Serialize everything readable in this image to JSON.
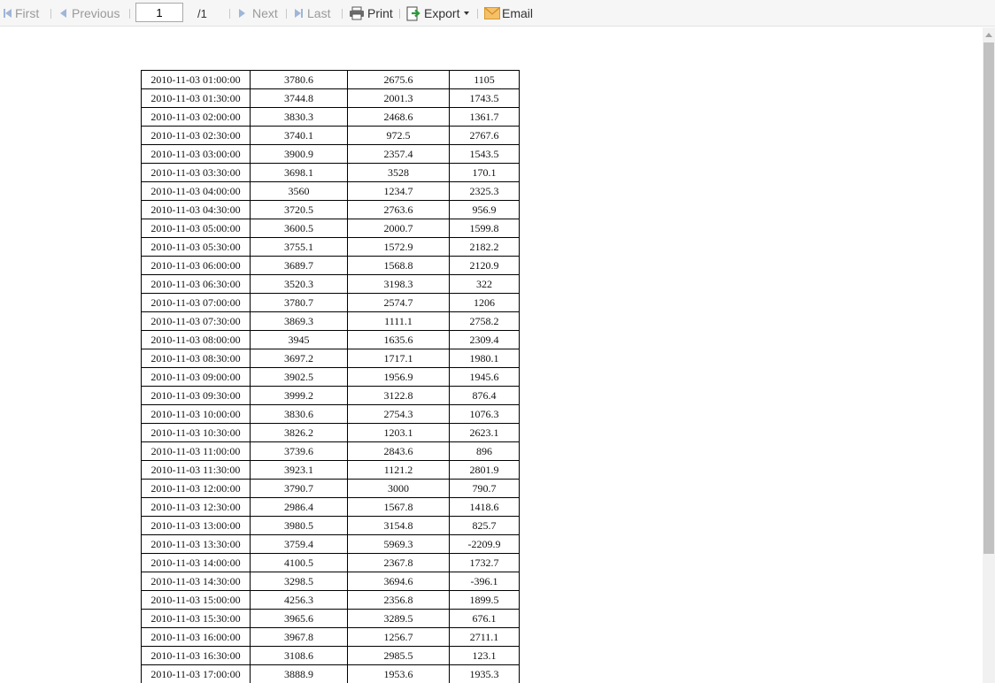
{
  "toolbar": {
    "first": "First",
    "previous": "Previous",
    "page_value": "1",
    "page_total": "/1",
    "next": "Next",
    "last": "Last",
    "print": "Print",
    "export": "Export",
    "email": "Email"
  },
  "rows": [
    [
      "2010-11-03 01:00:00",
      "3780.6",
      "2675.6",
      "1105"
    ],
    [
      "2010-11-03 01:30:00",
      "3744.8",
      "2001.3",
      "1743.5"
    ],
    [
      "2010-11-03 02:00:00",
      "3830.3",
      "2468.6",
      "1361.7"
    ],
    [
      "2010-11-03 02:30:00",
      "3740.1",
      "972.5",
      "2767.6"
    ],
    [
      "2010-11-03 03:00:00",
      "3900.9",
      "2357.4",
      "1543.5"
    ],
    [
      "2010-11-03 03:30:00",
      "3698.1",
      "3528",
      "170.1"
    ],
    [
      "2010-11-03 04:00:00",
      "3560",
      "1234.7",
      "2325.3"
    ],
    [
      "2010-11-03 04:30:00",
      "3720.5",
      "2763.6",
      "956.9"
    ],
    [
      "2010-11-03 05:00:00",
      "3600.5",
      "2000.7",
      "1599.8"
    ],
    [
      "2010-11-03 05:30:00",
      "3755.1",
      "1572.9",
      "2182.2"
    ],
    [
      "2010-11-03 06:00:00",
      "3689.7",
      "1568.8",
      "2120.9"
    ],
    [
      "2010-11-03 06:30:00",
      "3520.3",
      "3198.3",
      "322"
    ],
    [
      "2010-11-03 07:00:00",
      "3780.7",
      "2574.7",
      "1206"
    ],
    [
      "2010-11-03 07:30:00",
      "3869.3",
      "1111.1",
      "2758.2"
    ],
    [
      "2010-11-03 08:00:00",
      "3945",
      "1635.6",
      "2309.4"
    ],
    [
      "2010-11-03 08:30:00",
      "3697.2",
      "1717.1",
      "1980.1"
    ],
    [
      "2010-11-03 09:00:00",
      "3902.5",
      "1956.9",
      "1945.6"
    ],
    [
      "2010-11-03 09:30:00",
      "3999.2",
      "3122.8",
      "876.4"
    ],
    [
      "2010-11-03 10:00:00",
      "3830.6",
      "2754.3",
      "1076.3"
    ],
    [
      "2010-11-03 10:30:00",
      "3826.2",
      "1203.1",
      "2623.1"
    ],
    [
      "2010-11-03 11:00:00",
      "3739.6",
      "2843.6",
      "896"
    ],
    [
      "2010-11-03 11:30:00",
      "3923.1",
      "1121.2",
      "2801.9"
    ],
    [
      "2010-11-03 12:00:00",
      "3790.7",
      "3000",
      "790.7"
    ],
    [
      "2010-11-03 12:30:00",
      "2986.4",
      "1567.8",
      "1418.6"
    ],
    [
      "2010-11-03 13:00:00",
      "3980.5",
      "3154.8",
      "825.7"
    ],
    [
      "2010-11-03 13:30:00",
      "3759.4",
      "5969.3",
      "-2209.9"
    ],
    [
      "2010-11-03 14:00:00",
      "4100.5",
      "2367.8",
      "1732.7"
    ],
    [
      "2010-11-03 14:30:00",
      "3298.5",
      "3694.6",
      "-396.1"
    ],
    [
      "2010-11-03 15:00:00",
      "4256.3",
      "2356.8",
      "1899.5"
    ],
    [
      "2010-11-03 15:30:00",
      "3965.6",
      "3289.5",
      "676.1"
    ],
    [
      "2010-11-03 16:00:00",
      "3967.8",
      "1256.7",
      "2711.1"
    ],
    [
      "2010-11-03 16:30:00",
      "3108.6",
      "2985.5",
      "123.1"
    ],
    [
      "2010-11-03 17:00:00",
      "3888.9",
      "1953.6",
      "1935.3"
    ]
  ]
}
